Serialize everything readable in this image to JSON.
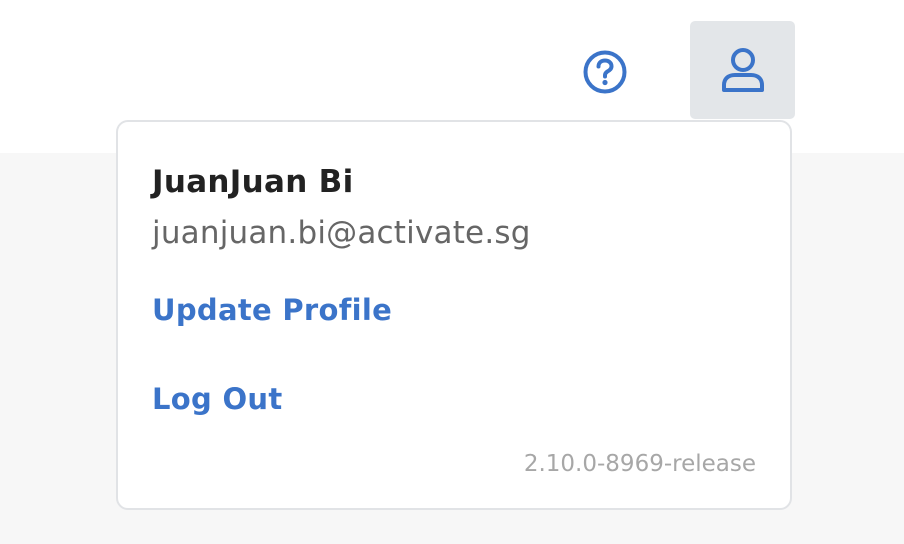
{
  "header": {
    "help_icon": "question-circle-icon",
    "user_icon": "user-icon",
    "accent_color": "#3b74c9"
  },
  "user_menu": {
    "name": "JuanJuan Bi",
    "email": "juanjuan.bi@activate.sg",
    "update_profile_label": "Update Profile",
    "logout_label": "Log Out",
    "version": "2.10.0-8969-release"
  }
}
